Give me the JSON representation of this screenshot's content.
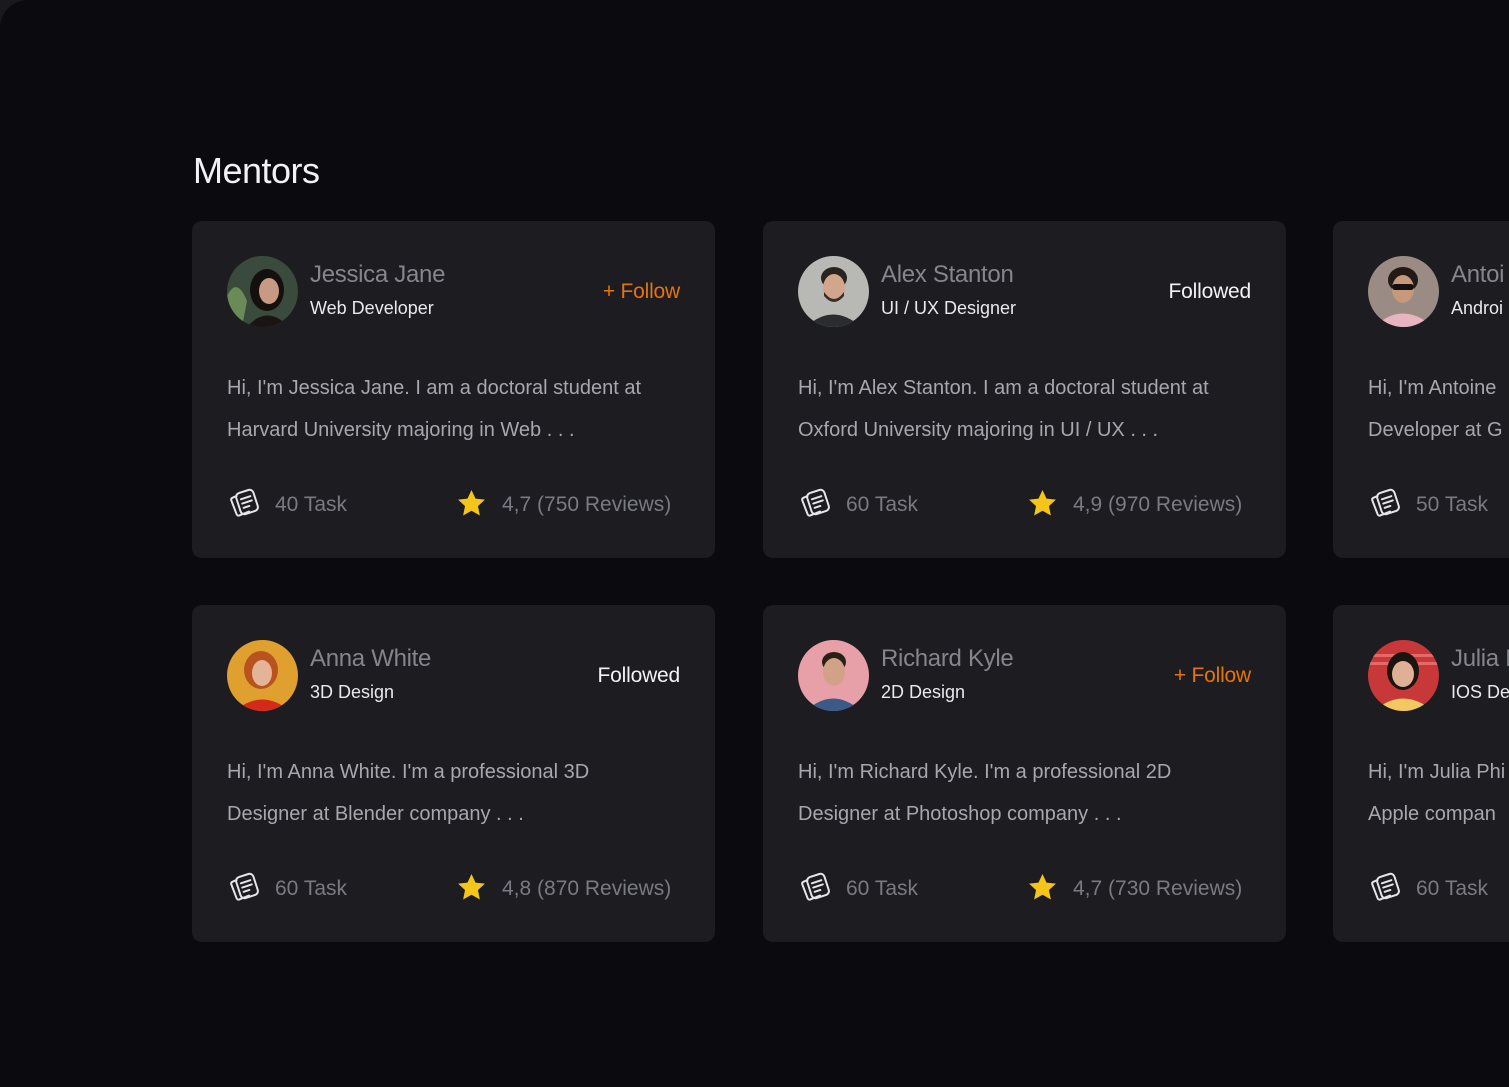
{
  "page": {
    "title": "Mentors"
  },
  "colors": {
    "background": "#0a0a0f",
    "card": "#1c1c21",
    "accent_follow": "#e8720c",
    "star": "#f5c518"
  },
  "icons": {
    "task": "task-list-icon",
    "rating": "star-icon"
  },
  "mentors": [
    {
      "name": "Jessica Jane",
      "role": "Web Developer",
      "follow_label": "+ Follow",
      "followed": false,
      "bio_line1": "Hi, I'm Jessica Jane. I am a doctoral student at",
      "bio_line2": "Harvard University majoring in Web . . .",
      "tasks": "40 Task",
      "rating": "4,7 (750 Reviews)"
    },
    {
      "name": "Alex Stanton",
      "role": "UI / UX Designer",
      "follow_label": "Followed",
      "followed": true,
      "bio_line1": "Hi, I'm Alex Stanton. I am a doctoral student at",
      "bio_line2": "Oxford University majoring in UI / UX  . . .",
      "tasks": "60 Task",
      "rating": "4,9 (970 Reviews)"
    },
    {
      "name": "Antoi",
      "role": "Androi",
      "follow_label": "",
      "followed": false,
      "bio_line1": "Hi, I'm Antoine",
      "bio_line2": "Developer at G",
      "tasks": "50 Task",
      "rating": ""
    },
    {
      "name": "Anna White",
      "role": "3D Design",
      "follow_label": "Followed",
      "followed": true,
      "bio_line1": "Hi, I'm Anna White. I'm a professional 3D",
      "bio_line2": "Designer at Blender company . . .",
      "tasks": "60 Task",
      "rating": "4,8 (870 Reviews)"
    },
    {
      "name": "Richard Kyle",
      "role": "2D Design",
      "follow_label": "+ Follow",
      "followed": false,
      "bio_line1": "Hi, I'm Richard Kyle. I'm a professional 2D",
      "bio_line2": "Designer at Photoshop company . . .",
      "tasks": "60 Task",
      "rating": "4,7 (730 Reviews)"
    },
    {
      "name": "Julia P",
      "role": "IOS De",
      "follow_label": "",
      "followed": false,
      "bio_line1": "Hi, I'm Julia Phi",
      "bio_line2": "Apple compan",
      "tasks": "60 Task",
      "rating": ""
    }
  ]
}
